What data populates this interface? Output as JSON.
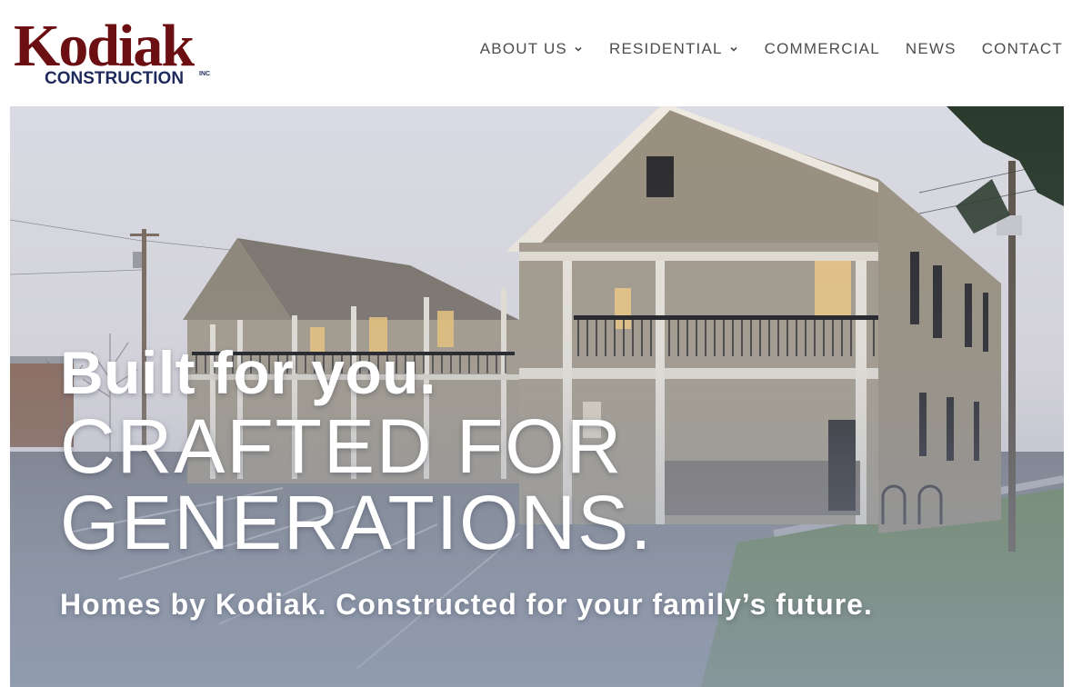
{
  "brand": {
    "name": "Kodiak",
    "subtitle": "CONSTRUCTION",
    "suffix": "INC",
    "color_primary": "#6b0f12",
    "color_secondary": "#1f2a5c"
  },
  "nav": {
    "items": [
      {
        "label": "ABOUT US",
        "has_dropdown": true
      },
      {
        "label": "RESIDENTIAL",
        "has_dropdown": true
      },
      {
        "label": "COMMERCIAL",
        "has_dropdown": false
      },
      {
        "label": "NEWS",
        "has_dropdown": false
      },
      {
        "label": "CONTACT",
        "has_dropdown": false
      }
    ]
  },
  "hero": {
    "line1": "Built for you.",
    "line2a": "CRAFTED FOR",
    "line2b": "GENERATIONS.",
    "subline": "Homes by Kodiak. Constructed for your family’s future."
  }
}
